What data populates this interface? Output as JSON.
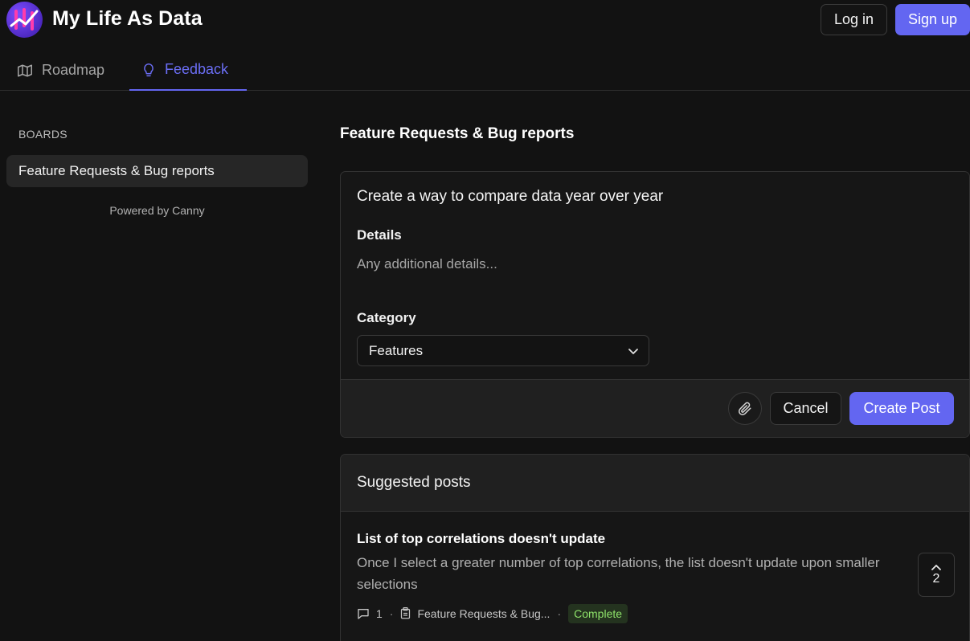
{
  "header": {
    "app_title": "My Life As Data",
    "login_label": "Log in",
    "signup_label": "Sign up"
  },
  "nav": {
    "tabs": [
      {
        "label": "Roadmap",
        "icon": "map-icon",
        "active": false
      },
      {
        "label": "Feedback",
        "icon": "lightbulb-icon",
        "active": true
      }
    ]
  },
  "sidebar": {
    "boards_label": "BOARDS",
    "boards": [
      {
        "label": "Feature Requests & Bug reports"
      }
    ],
    "powered_by": "Powered by Canny"
  },
  "main": {
    "board_title": "Feature Requests & Bug reports",
    "form": {
      "title_value": "Create a way to compare data year over year",
      "details_label": "Details",
      "details_placeholder": "Any additional details...",
      "category_label": "Category",
      "category_value": "Features",
      "cancel_label": "Cancel",
      "create_label": "Create Post"
    },
    "suggested": {
      "heading": "Suggested posts",
      "posts": [
        {
          "title": "List of top correlations doesn't update",
          "description": "Once I select a greater number of top correlations, the list doesn't update upon smaller selections",
          "comments": "1",
          "board": "Feature Requests & Bug...",
          "status": "Complete",
          "votes": "2"
        }
      ]
    }
  },
  "colors": {
    "accent": "#6366f1",
    "background": "#121212",
    "status_complete": "#8ee26a"
  }
}
